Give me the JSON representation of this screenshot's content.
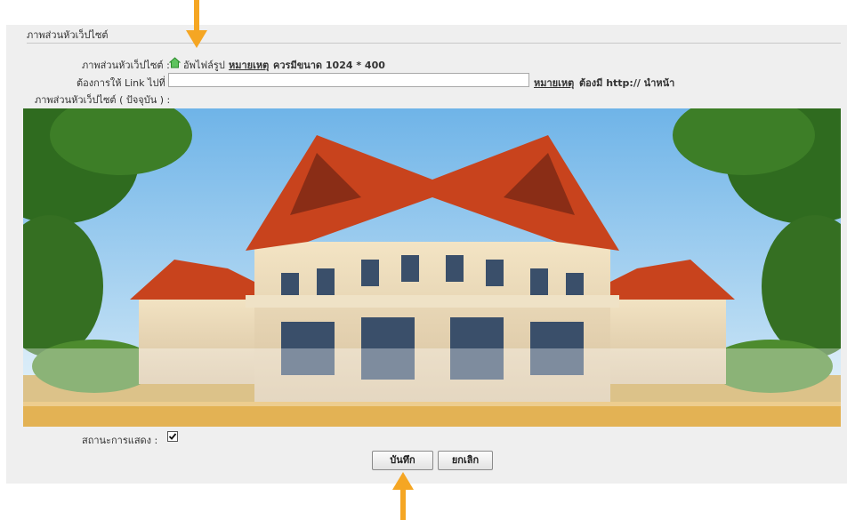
{
  "section": {
    "title": "ภาพส่วนหัวเว็ปไซต์"
  },
  "upload_row": {
    "label": "ภาพส่วนหัวเว็ปไซต์ :",
    "upload_link": "อัพไฟล์รูป",
    "note_link": "หมายเหตุ",
    "note_text": "ควรมีขนาด 1024 * 400"
  },
  "link_row": {
    "label": "ต้องการให้ Link ไปที่ :",
    "value": "",
    "note_link": "หมายเหตุ",
    "note_text": "ต้องมี http:// นำหน้า"
  },
  "current_label": "ภาพส่วนหัวเว็ปไซต์ ( ปัจจุบัน ) :",
  "status_row": {
    "label": "สถานะการแสดง :",
    "checked": true
  },
  "buttons": {
    "save": "บันทึก",
    "cancel": "ยกเลิก"
  },
  "colors": {
    "arrow": "#f5a623",
    "panel": "#efefef",
    "upload_icon": "#2aa52a"
  },
  "icons": {
    "upload": "house-upload-icon",
    "check": "checkmark-icon",
    "arrow": "arrow-icon"
  }
}
